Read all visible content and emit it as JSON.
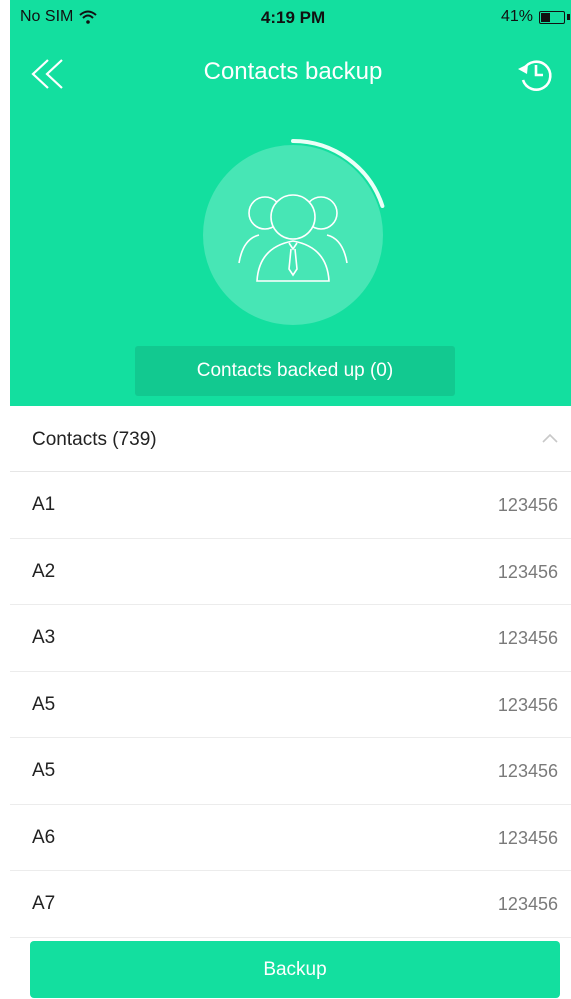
{
  "status_bar": {
    "carrier": "No SIM",
    "time": "4:19 PM",
    "battery": "41%",
    "battery_level": 0.41
  },
  "nav": {
    "title": "Contacts backup"
  },
  "backup_counter": {
    "label": "Contacts backed up (0)",
    "progress_arc_fraction": 0.2
  },
  "contacts": {
    "title": "Contacts (739)",
    "rows": [
      {
        "name": "A1",
        "number": "123456"
      },
      {
        "name": "A2",
        "number": "123456"
      },
      {
        "name": "A3",
        "number": "123456"
      },
      {
        "name": "A5",
        "number": "123456"
      },
      {
        "name": "A5",
        "number": "123456"
      },
      {
        "name": "A6",
        "number": "123456"
      },
      {
        "name": "A7",
        "number": "123456"
      }
    ]
  },
  "actions": {
    "backup_label": "Backup"
  },
  "colors": {
    "accent": "#13df9f",
    "accent_dark": "#12c990",
    "text": "#222222",
    "muted": "#7a7a7a"
  },
  "icons": {
    "back": "double-chevron-left-icon",
    "history": "history-icon",
    "contacts": "contacts-group-icon",
    "collapse": "chevron-up-icon"
  }
}
